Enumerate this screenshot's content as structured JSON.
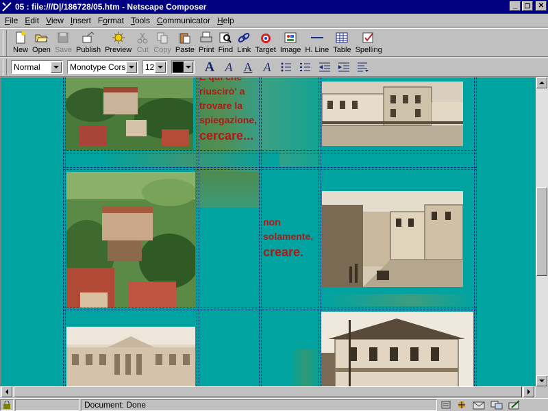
{
  "window": {
    "title": "05 : file:///D|/186728/05.htm - Netscape Composer",
    "min_glyph": "_",
    "max_glyph": "❐",
    "close_glyph": "✕"
  },
  "menu": [
    {
      "pre": "",
      "ul": "F",
      "post": "ile"
    },
    {
      "pre": "",
      "ul": "E",
      "post": "dit"
    },
    {
      "pre": "",
      "ul": "V",
      "post": "iew"
    },
    {
      "pre": "",
      "ul": "I",
      "post": "nsert"
    },
    {
      "pre": "F",
      "ul": "o",
      "post": "rmat"
    },
    {
      "pre": "",
      "ul": "T",
      "post": "ools"
    },
    {
      "pre": "",
      "ul": "C",
      "post": "ommunicator"
    },
    {
      "pre": "",
      "ul": "H",
      "post": "elp"
    }
  ],
  "toolbar": [
    {
      "label": "New",
      "icon": "new-page-icon",
      "disabled": false
    },
    {
      "label": "Open",
      "icon": "open-folder-icon",
      "disabled": false
    },
    {
      "label": "Save",
      "icon": "save-disk-icon",
      "disabled": true
    },
    {
      "label": "Publish",
      "icon": "publish-icon",
      "disabled": false
    },
    {
      "label": "Preview",
      "icon": "preview-icon",
      "disabled": false
    },
    {
      "label": "Cut",
      "icon": "scissors-icon",
      "disabled": true
    },
    {
      "label": "Copy",
      "icon": "copy-icon",
      "disabled": true
    },
    {
      "label": "Paste",
      "icon": "paste-icon",
      "disabled": false
    },
    {
      "label": "Print",
      "icon": "printer-icon",
      "disabled": false
    },
    {
      "label": "Find",
      "icon": "find-icon",
      "disabled": false
    },
    {
      "label": "Link",
      "icon": "link-icon",
      "disabled": false
    },
    {
      "label": "Target",
      "icon": "target-icon",
      "disabled": false
    },
    {
      "label": "Image",
      "icon": "image-icon",
      "disabled": false
    },
    {
      "label": "H. Line",
      "icon": "horizontal-line-icon",
      "disabled": false
    },
    {
      "label": "Table",
      "icon": "table-icon",
      "disabled": false
    },
    {
      "label": "Spelling",
      "icon": "spelling-icon",
      "disabled": false
    }
  ],
  "format": {
    "paragraph_style": "Normal",
    "font_face": "Monotype Corsiva",
    "font_size": "12",
    "text_color": "#000000",
    "buttons": [
      {
        "name": "bigger-font-button",
        "glyph": "A"
      },
      {
        "name": "italic-a-button",
        "glyph": "A"
      },
      {
        "name": "underline-a-button",
        "glyph": "A"
      },
      {
        "name": "clear-styles-button",
        "glyph": "A"
      }
    ]
  },
  "content": {
    "text1": {
      "lines": [
        "E qui che",
        "riuscirò' a",
        "trovare la",
        "spiegazione,"
      ],
      "big": "cercare..."
    },
    "text2": {
      "lines": [
        "non",
        "solamente,"
      ],
      "big": "creare."
    }
  },
  "status": {
    "text": "Document: Done"
  },
  "colors": {
    "page_bg": "#00a3a0",
    "text_red": "#b01818",
    "title_bar": "#000080"
  }
}
